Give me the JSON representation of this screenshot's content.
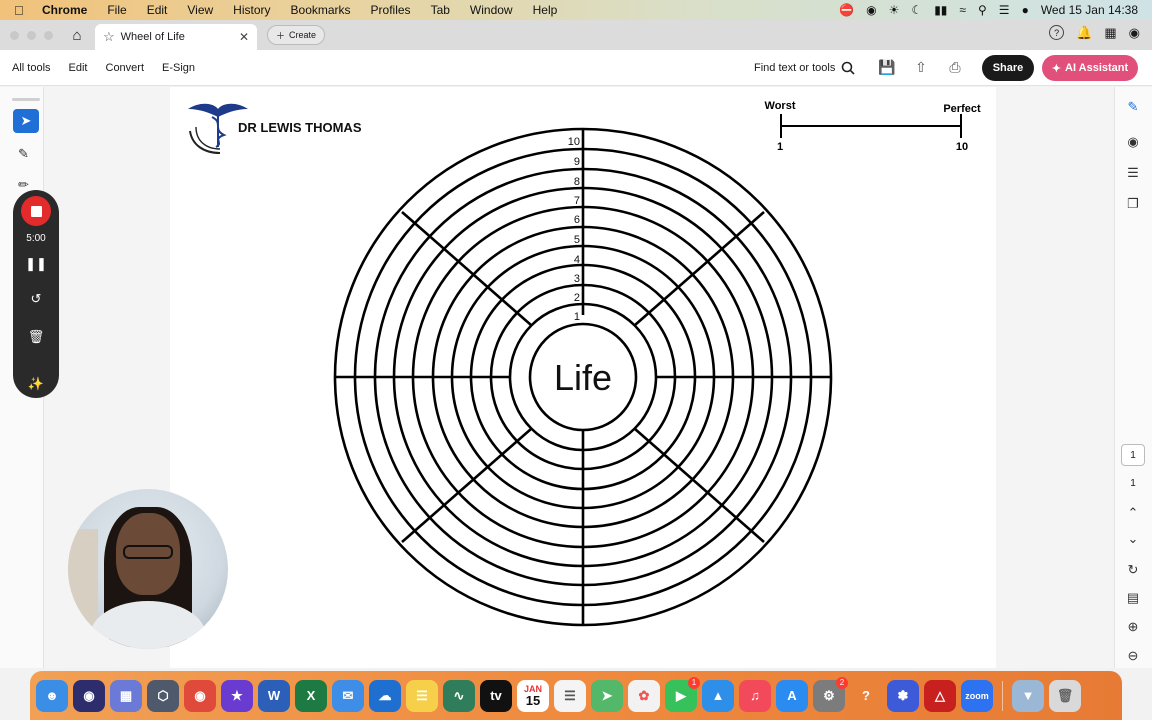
{
  "menubar": {
    "app": "Chrome",
    "items": [
      "File",
      "Edit",
      "View",
      "History",
      "Bookmarks",
      "Profiles",
      "Tab",
      "Window",
      "Help"
    ],
    "clock": "Wed 15 Jan  14:38"
  },
  "browser": {
    "tab_title": "Wheel of Life",
    "new_tab_label": "Create"
  },
  "toolbar": {
    "all_tools": "All tools",
    "edit": "Edit",
    "convert": "Convert",
    "esign": "E-Sign",
    "find": "Find text or tools",
    "share": "Share",
    "ai_assistant": "AI Assistant"
  },
  "recorder": {
    "time": "5:00"
  },
  "document": {
    "brand": "DR LEWIS THOMAS",
    "center_label": "Life",
    "scale": {
      "worst_label": "Worst",
      "perfect_label": "Perfect",
      "min": "1",
      "max": "10"
    },
    "ring_numbers": [
      "1",
      "2",
      "3",
      "4",
      "5",
      "6",
      "7",
      "8",
      "9",
      "10"
    ]
  },
  "pagination": {
    "current": "1",
    "total": "1"
  },
  "dock": {
    "calendar_month": "JAN",
    "calendar_day": "15",
    "facetime_badge": "1",
    "settings_badge": "2",
    "zoom_label": "zoom"
  },
  "colors": {
    "accent_blue": "#1f6fd6",
    "ai_pink": "#e0507a",
    "record_red": "#e32b2b",
    "dock_orange": "#ef8a3e"
  }
}
